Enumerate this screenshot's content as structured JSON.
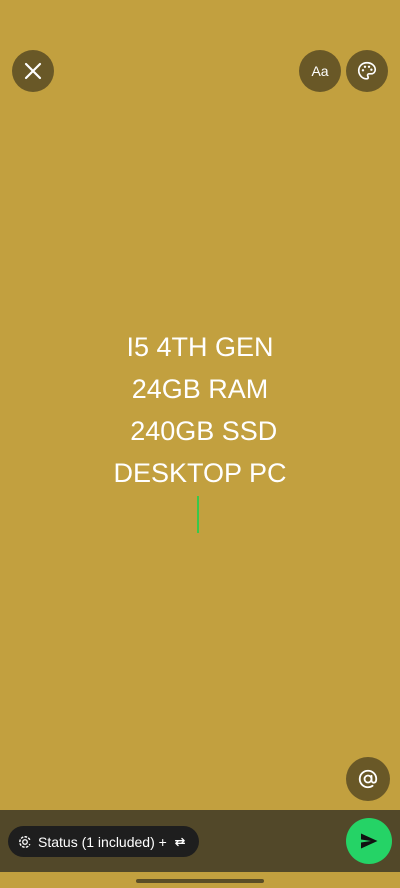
{
  "composer": {
    "background_color": "#C2A03F",
    "text_lines": [
      "I5 4TH GEN",
      "24GB RAM",
      " 240GB SSD",
      "DESKTOP PC"
    ],
    "cursor_color": "#39c84a"
  },
  "toolbar": {
    "close_icon": "close-icon",
    "font_button_label": "Aa",
    "palette_icon": "palette-icon"
  },
  "mention_icon": "at-sign-icon",
  "footer": {
    "audience_label": "Status (1 included) +",
    "send_color": "#25D366",
    "send_icon": "send-icon"
  }
}
